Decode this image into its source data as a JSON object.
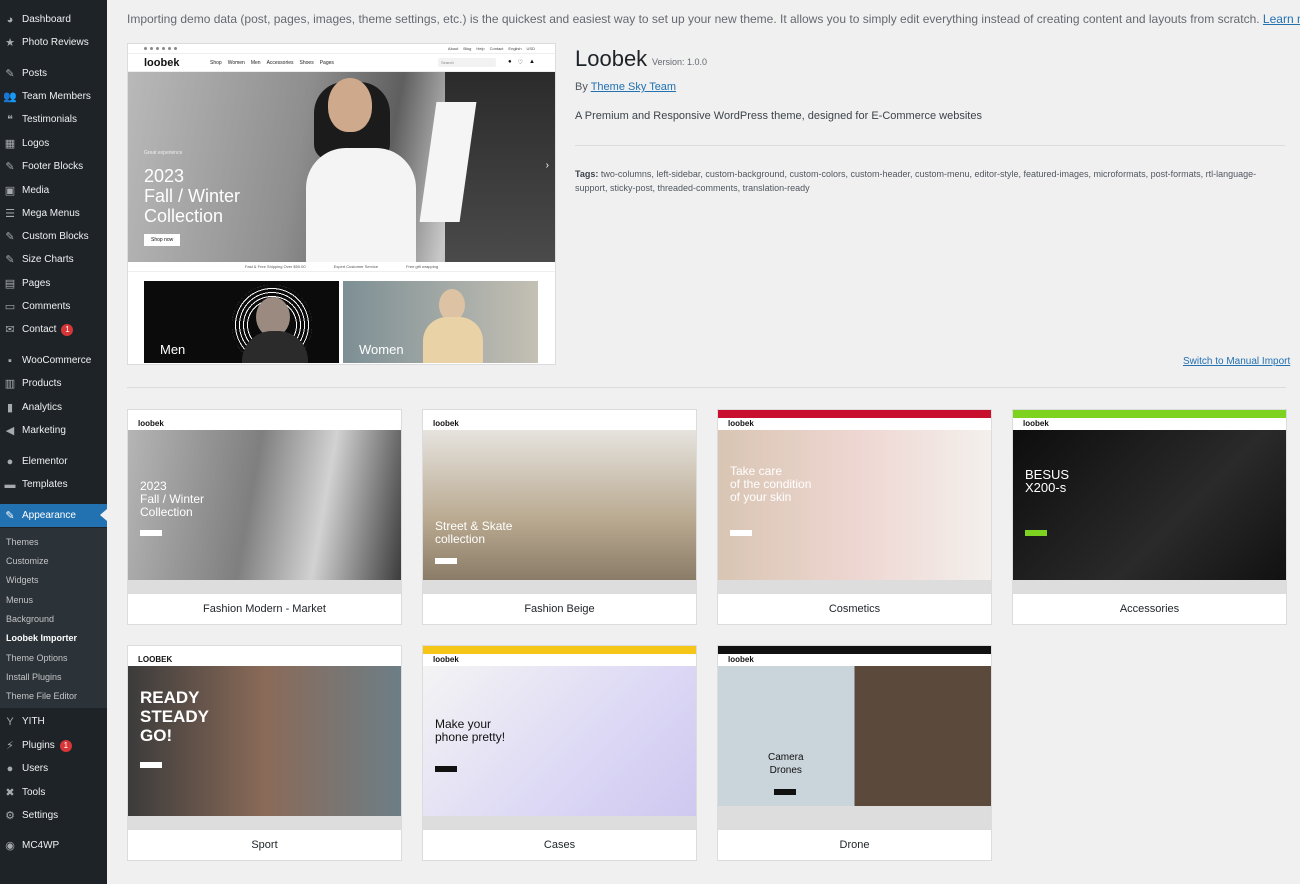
{
  "sidebar": {
    "items": [
      {
        "label": "Dashboard",
        "icon": "dashboard-icon",
        "glyph": "◕"
      },
      {
        "label": "Photo Reviews",
        "icon": "star-icon",
        "glyph": "★"
      },
      {
        "label": "Posts",
        "icon": "pin-icon",
        "glyph": "✎"
      },
      {
        "label": "Team Members",
        "icon": "users-icon",
        "glyph": "👥"
      },
      {
        "label": "Testimonials",
        "icon": "quote-icon",
        "glyph": "❝"
      },
      {
        "label": "Logos",
        "icon": "grid-icon",
        "glyph": "▦"
      },
      {
        "label": "Footer Blocks",
        "icon": "pin-icon",
        "glyph": "✎"
      },
      {
        "label": "Media",
        "icon": "media-icon",
        "glyph": "▣"
      },
      {
        "label": "Mega Menus",
        "icon": "menu-icon",
        "glyph": "☰"
      },
      {
        "label": "Custom Blocks",
        "icon": "pin-icon",
        "glyph": "✎"
      },
      {
        "label": "Size Charts",
        "icon": "pin-icon",
        "glyph": "✎"
      },
      {
        "label": "Pages",
        "icon": "page-icon",
        "glyph": "▤"
      },
      {
        "label": "Comments",
        "icon": "comment-icon",
        "glyph": "▭"
      },
      {
        "label": "Contact",
        "icon": "mail-icon",
        "glyph": "✉",
        "badge": "1"
      },
      {
        "label": "WooCommerce",
        "icon": "woo-icon",
        "glyph": "▪"
      },
      {
        "label": "Products",
        "icon": "archive-icon",
        "glyph": "▥"
      },
      {
        "label": "Analytics",
        "icon": "analytics-icon",
        "glyph": "▮"
      },
      {
        "label": "Marketing",
        "icon": "megaphone-icon",
        "glyph": "◀"
      },
      {
        "label": "Elementor",
        "icon": "elementor-icon",
        "glyph": "●"
      },
      {
        "label": "Templates",
        "icon": "folder-icon",
        "glyph": "▬"
      },
      {
        "label": "Appearance",
        "icon": "brush-icon",
        "glyph": "✎",
        "active": true
      },
      {
        "label": "YITH",
        "icon": "yith-icon",
        "glyph": "Y"
      },
      {
        "label": "Plugins",
        "icon": "plug-icon",
        "glyph": "⚡",
        "badge": "1"
      },
      {
        "label": "Users",
        "icon": "user-icon",
        "glyph": "●"
      },
      {
        "label": "Tools",
        "icon": "wrench-icon",
        "glyph": "✖"
      },
      {
        "label": "Settings",
        "icon": "settings-icon",
        "glyph": "⚙"
      },
      {
        "label": "MC4WP",
        "icon": "mc4wp-icon",
        "glyph": "◉"
      }
    ],
    "submenu": [
      {
        "label": "Themes"
      },
      {
        "label": "Customize"
      },
      {
        "label": "Widgets"
      },
      {
        "label": "Menus"
      },
      {
        "label": "Background"
      },
      {
        "label": "Loobek Importer",
        "current": true
      },
      {
        "label": "Theme Options"
      },
      {
        "label": "Install Plugins"
      },
      {
        "label": "Theme File Editor"
      }
    ]
  },
  "intro": {
    "text": "Importing demo data (post, pages, images, theme settings, etc.) is the quickest and easiest way to set up your new theme. It allows you to simply edit everything instead of creating content and layouts from scratch.",
    "link": "Learn more"
  },
  "preview": {
    "logo": "loobek",
    "nav": [
      "Shop",
      "Women",
      "Men",
      "Accessories",
      "Shoes",
      "Pages"
    ],
    "top_links": [
      "About",
      "Blog",
      "Help",
      "Contact",
      "English",
      "USD"
    ],
    "search_placeholder": "Search",
    "hero_small": "Great experience",
    "hero_lines": [
      "2023",
      "Fall / Winter",
      "Collection"
    ],
    "hero_button": "Shop now",
    "features": [
      "Fast & Free Shipping Over $50.00",
      "Expert Customer Service",
      "Free gift wrapping"
    ],
    "categories": [
      "Men",
      "Women"
    ]
  },
  "theme": {
    "name": "Loobek",
    "version": "Version: 1.0.0",
    "by_prefix": "By",
    "author": "Theme Sky Team",
    "description": "A Premium and Responsive WordPress theme, designed for E-Commerce websites",
    "tags_label": "Tags:",
    "tags": "two-columns, left-sidebar, custom-background, custom-colors, custom-header, custom-menu, editor-style, featured-images, microformats, post-formats, rtl-language-support, sticky-post, threaded-comments, translation-ready"
  },
  "manual_import": "Switch to Manual Import",
  "demos": [
    {
      "label": "Fashion Modern - Market",
      "hero": [
        "2023",
        "Fall / Winter",
        "Collection"
      ],
      "theme": "fashion"
    },
    {
      "label": "Fashion Beige",
      "hero": [
        "Street & Skate",
        "collection"
      ],
      "theme": "beige"
    },
    {
      "label": "Cosmetics",
      "hero": [
        "Take care",
        "of the condition",
        "of your skin"
      ],
      "theme": "cosmetics"
    },
    {
      "label": "Accessories",
      "hero": [
        "BESUS",
        "X200-s"
      ],
      "theme": "accessories"
    },
    {
      "label": "Sport",
      "hero": [
        "READY",
        "STEADY",
        "GO!"
      ],
      "theme": "sport"
    },
    {
      "label": "Cases",
      "hero": [
        "Make your",
        "phone pretty!"
      ],
      "theme": "cases"
    },
    {
      "label": "Drone",
      "hero": [
        "Camera",
        "Drones"
      ],
      "theme": "drone"
    }
  ]
}
